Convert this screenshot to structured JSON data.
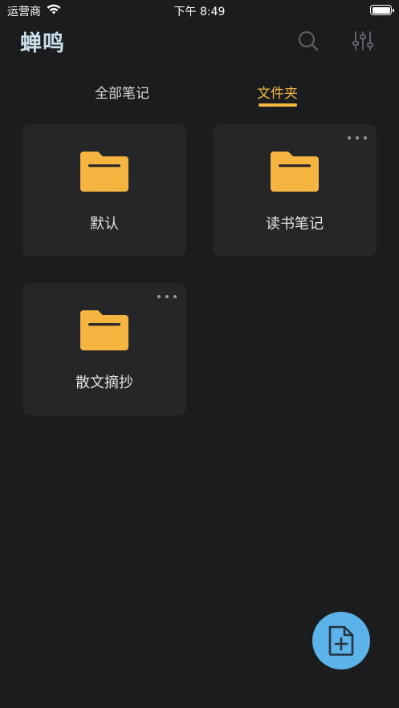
{
  "status_bar": {
    "carrier": "运营商",
    "time": "下午 8:49",
    "wifi_icon": "wifi-icon",
    "battery_icon": "battery-icon"
  },
  "header": {
    "title": "蝉鸣",
    "search_icon": "search-icon",
    "filter_icon": "sliders-icon"
  },
  "tabs": [
    {
      "label": "全部笔记",
      "active": false
    },
    {
      "label": "文件夹",
      "active": true
    }
  ],
  "folders": [
    {
      "name": "默认",
      "has_menu": false
    },
    {
      "name": "读书笔记",
      "has_menu": true
    },
    {
      "name": "散文摘抄",
      "has_menu": true
    }
  ],
  "fab": {
    "icon": "new-note-icon"
  },
  "colors": {
    "accent": "#f5b840",
    "background": "#1b1c1e",
    "card": "#262628",
    "fab": "#5bb3ea",
    "title": "#c8dfe9"
  }
}
